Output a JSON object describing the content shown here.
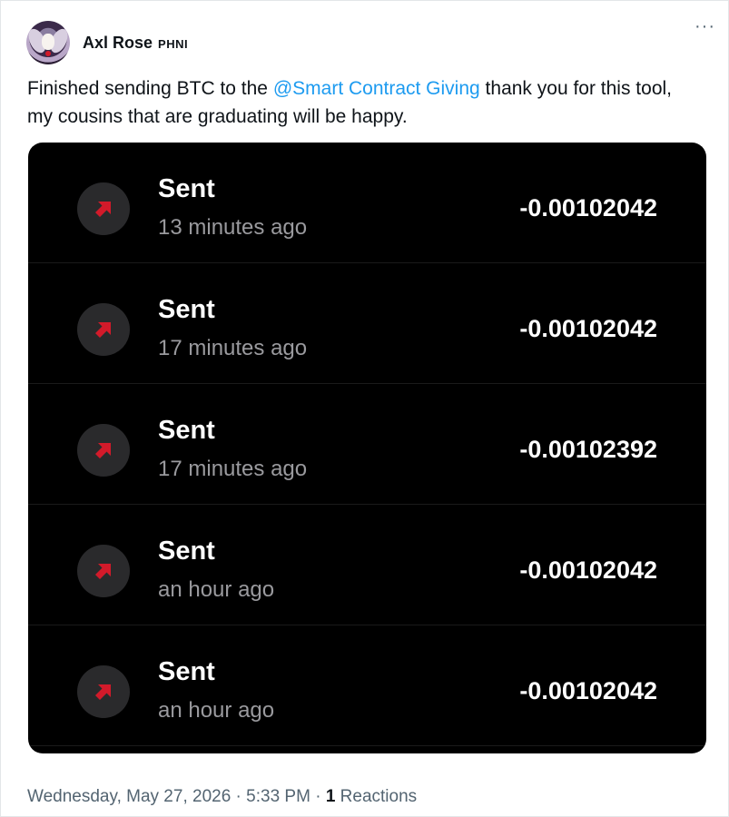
{
  "post": {
    "author_name": "Axl Rose",
    "author_handle": "PHNI",
    "more_label": "···",
    "text_before": "Finished sending BTC to the ",
    "mention": "@Smart Contract Giving",
    "text_after": " thank you for this tool, my cousins that are graduating will be happy."
  },
  "transactions": [
    {
      "title": "Sent",
      "time": "13 minutes ago",
      "amount": "-0.00102042"
    },
    {
      "title": "Sent",
      "time": "17 minutes ago",
      "amount": "-0.00102042"
    },
    {
      "title": "Sent",
      "time": "17 minutes ago",
      "amount": "-0.00102392"
    },
    {
      "title": "Sent",
      "time": "an hour ago",
      "amount": "-0.00102042"
    },
    {
      "title": "Sent",
      "time": "an hour ago",
      "amount": "-0.00102042"
    }
  ],
  "footer": {
    "timestamp": "Wednesday, May 27, 2026 · 5:33 PM · ",
    "reactions_count": "1",
    "reactions_label": " Reactions"
  },
  "colors": {
    "mention": "#1d9bf0",
    "sent_arrow": "#d21a2a",
    "card_bg": "#000000"
  },
  "icons": {
    "transaction": "arrow-up-right-icon",
    "more": "more-options-icon"
  }
}
